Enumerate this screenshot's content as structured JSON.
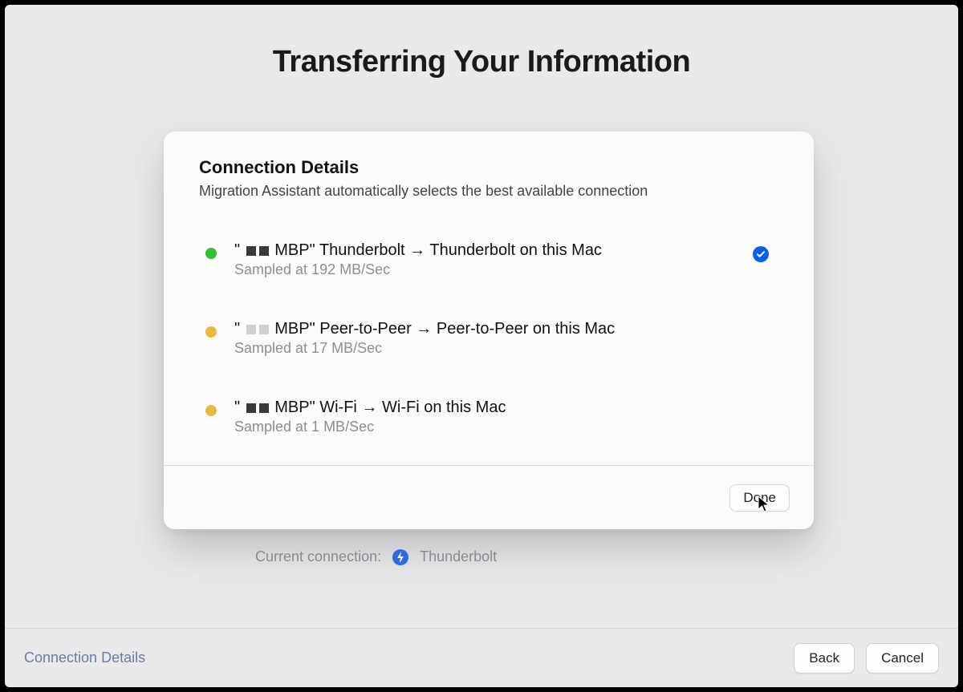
{
  "page": {
    "title": "Transferring Your Information"
  },
  "sheet": {
    "title": "Connection Details",
    "subtitle": "Migration Assistant automatically selects the best available connection",
    "connections": [
      {
        "status_color": "green",
        "source_prefix": "\"",
        "source_name": "MBP\" Thunderbolt",
        "arrow": "→",
        "target": "Thunderbolt on this Mac",
        "sample": "Sampled at 192 MB/Sec",
        "selected": true
      },
      {
        "status_color": "yellow",
        "source_prefix": "\"",
        "source_name": "MBP\" Peer-to-Peer",
        "arrow": "→",
        "target": "Peer-to-Peer on this Mac",
        "sample": "Sampled at 17 MB/Sec",
        "selected": false
      },
      {
        "status_color": "yellow",
        "source_prefix": "\"",
        "source_name": "MBP\" Wi-Fi",
        "arrow": "→",
        "target": "Wi-Fi on this Mac",
        "sample": "Sampled at 1 MB/Sec",
        "selected": false
      }
    ],
    "done_label": "Done"
  },
  "current_connection": {
    "label": "Current connection:",
    "icon": "thunderbolt-icon",
    "value": "Thunderbolt"
  },
  "bottom": {
    "link_label": "Connection Details",
    "back_label": "Back",
    "cancel_label": "Cancel"
  },
  "colors": {
    "green": "#30c030",
    "yellow": "#e8b93e",
    "accent_blue": "#0a5fe8"
  }
}
